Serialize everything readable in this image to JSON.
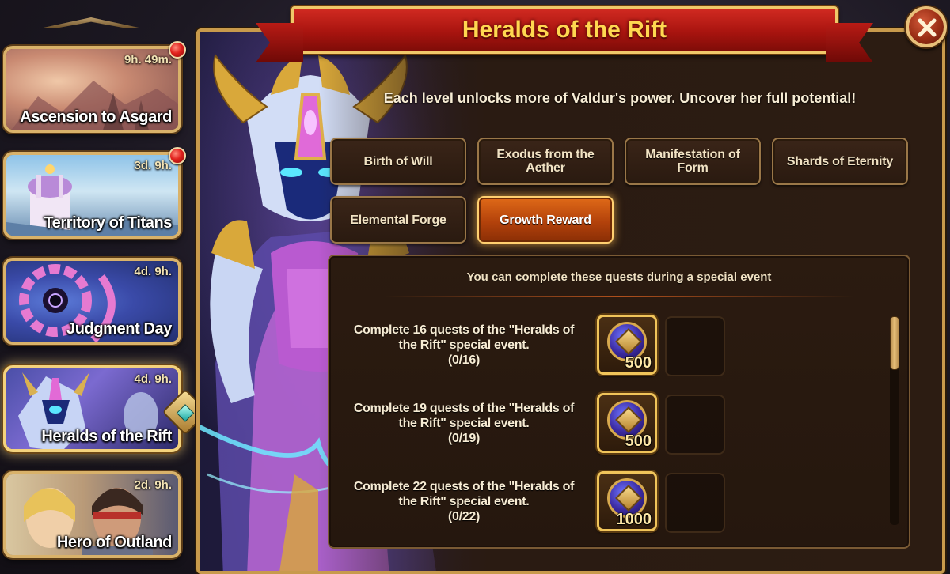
{
  "window": {
    "title": "Heralds of the Rift"
  },
  "sidebar": {
    "events": [
      {
        "name": "Ascension to Asgard",
        "timer": "9h. 49m.",
        "notification": true,
        "active": false
      },
      {
        "name": "Territory of Titans",
        "timer": "3d. 9h.",
        "notification": true,
        "active": false
      },
      {
        "name": "Judgment Day",
        "timer": "4d. 9h.",
        "notification": false,
        "active": false
      },
      {
        "name": "Heralds of the Rift",
        "timer": "4d. 9h.",
        "notification": false,
        "active": true
      },
      {
        "name": "Hero of Outland",
        "timer": "2d. 9h.",
        "notification": false,
        "active": false
      }
    ]
  },
  "main": {
    "subtitle": "Each level unlocks more of Valdur's power. Uncover her full potential!",
    "tabs": [
      {
        "label": "Birth of Will",
        "active": false
      },
      {
        "label": "Exodus from the Aether",
        "active": false
      },
      {
        "label": "Manifestation of Form",
        "active": false
      },
      {
        "label": "Shards of Eternity",
        "active": false
      },
      {
        "label": "Elemental Forge",
        "active": false
      },
      {
        "label": "Growth Reward",
        "active": true
      }
    ],
    "quest_header": "You can complete these quests during a special event",
    "quests": [
      {
        "line1": "Complete 16 quests of the \"Heralds of",
        "line2": "the Rift\" special event.",
        "progress": "(0/16)",
        "reward_amount": "500",
        "reward_icon": "artifact-coin-icon"
      },
      {
        "line1": "Complete 19 quests of the \"Heralds of",
        "line2": "the Rift\" special event.",
        "progress": "(0/19)",
        "reward_amount": "500",
        "reward_icon": "artifact-coin-icon"
      },
      {
        "line1": "Complete 22 quests of the \"Heralds of",
        "line2": "the Rift\" special event.",
        "progress": "(0/22)",
        "reward_amount": "1000",
        "reward_icon": "artifact-coin-icon"
      }
    ]
  },
  "colors": {
    "banner_red": "#b8170f",
    "title_gold": "#ffd750",
    "frame_gold": "#d9b26a",
    "active_tab_orange": "#d35a14",
    "panel_brown": "#2b1b10"
  }
}
